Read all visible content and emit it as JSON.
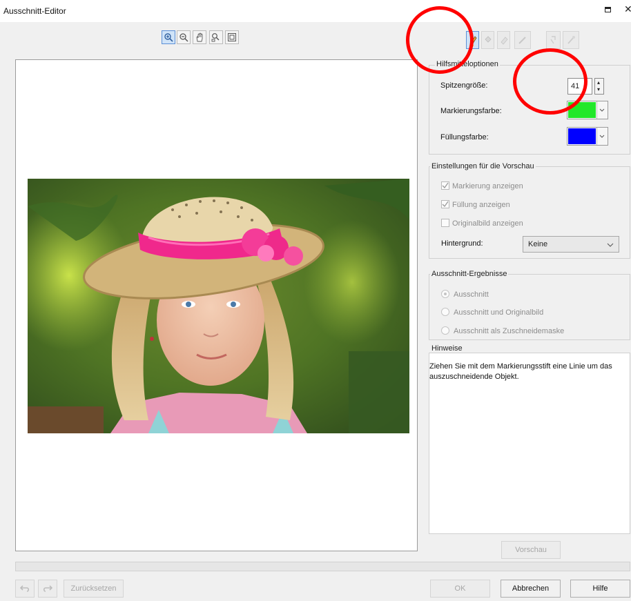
{
  "window": {
    "title": "Ausschnitt-Editor"
  },
  "toolbar": {
    "view_tools": [
      "zoom-in-icon",
      "zoom-out-icon",
      "pan-hand-icon",
      "zoom-fit-icon",
      "actual-size-icon"
    ],
    "edit_tools": [
      "highlighter-pen-icon",
      "fill-bucket-icon",
      "eraser-icon",
      "cleanup-brush-icon",
      "restore-brush-icon"
    ]
  },
  "tool_options": {
    "group_title": "Hilfsmitteloptionen",
    "nib_size_label": "Spitzengröße:",
    "nib_size_value": "41",
    "highlight_color_label": "Markierungsfarbe:",
    "highlight_color": "#22e82a",
    "fill_color_label": "Füllungsfarbe:",
    "fill_color": "#0000ff"
  },
  "preview_settings": {
    "group_title": "Einstellungen für die Vorschau",
    "show_highlight": {
      "label": "Markierung anzeigen",
      "checked": true
    },
    "show_fill": {
      "label": "Füllung anzeigen",
      "checked": true
    },
    "show_original": {
      "label": "Originalbild anzeigen",
      "checked": false
    },
    "background_label": "Hintergrund:",
    "background_value": "Keine"
  },
  "cutout_results": {
    "group_title": "Ausschnitt-Ergebnisse",
    "options": [
      {
        "label": "Ausschnitt",
        "selected": true
      },
      {
        "label": "Ausschnitt und Originalbild",
        "selected": false
      },
      {
        "label": "Ausschnitt als Zuschneidemaske",
        "selected": false
      }
    ]
  },
  "hints": {
    "title": "Hinweise",
    "text": "Ziehen Sie mit dem Markierungsstift eine Linie um das auszuschneidende Objekt."
  },
  "buttons": {
    "preview": "Vorschau",
    "reset": "Zurücksetzen",
    "ok": "OK",
    "cancel": "Abbrechen",
    "help": "Hilfe"
  },
  "accent_colors": {
    "annotation_circle": "#ff0000",
    "hat_band": "#f0288c"
  }
}
